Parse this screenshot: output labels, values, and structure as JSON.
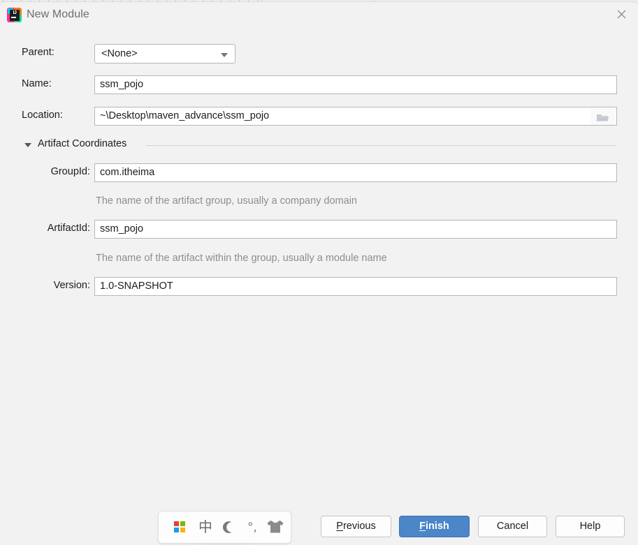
{
  "window": {
    "title": "New Module",
    "app_icon": "intellij-idea-icon",
    "app_icon_text": "IJ",
    "close_icon": "close-icon"
  },
  "form": {
    "parent": {
      "label": "Parent:",
      "value": "<None>",
      "dropdown_icon": "chevron-down-icon"
    },
    "name": {
      "label": "Name:",
      "value": "ssm_pojo"
    },
    "location": {
      "label": "Location:",
      "value": "~\\Desktop\\maven_advance\\ssm_pojo",
      "browse_icon": "folder-icon"
    }
  },
  "artifact_section": {
    "title": "Artifact Coordinates",
    "collapse_icon": "triangle-down-icon",
    "group_id": {
      "label": "GroupId:",
      "value": "com.itheima",
      "hint": "The name of the artifact group, usually a company domain"
    },
    "artifact_id": {
      "label": "ArtifactId:",
      "value": "ssm_pojo",
      "hint": "The name of the artifact within the group, usually a module name"
    },
    "version": {
      "label": "Version:",
      "value": "1.0-SNAPSHOT"
    }
  },
  "buttons": {
    "previous": {
      "label": "Previous",
      "mnemonic": "P",
      "rest": "revious"
    },
    "finish": {
      "label": "Finish",
      "mnemonic": "F",
      "rest": "inish"
    },
    "cancel": {
      "label": "Cancel"
    },
    "help": {
      "label": "Help"
    }
  },
  "ime_toolbar": {
    "windows_logo": "windows-logo-icon",
    "language_mode": "中",
    "shape_mode_icon": "crescent-moon-icon",
    "punctuation_mode": "°,",
    "skin_icon": "t-shirt-icon"
  },
  "colors": {
    "primary_button": "#4a86c8",
    "dialog_background": "#f2f2f2",
    "field_background": "#ffffff",
    "hint_text": "#8d8d8d",
    "title_text": "#6e6e6e"
  }
}
